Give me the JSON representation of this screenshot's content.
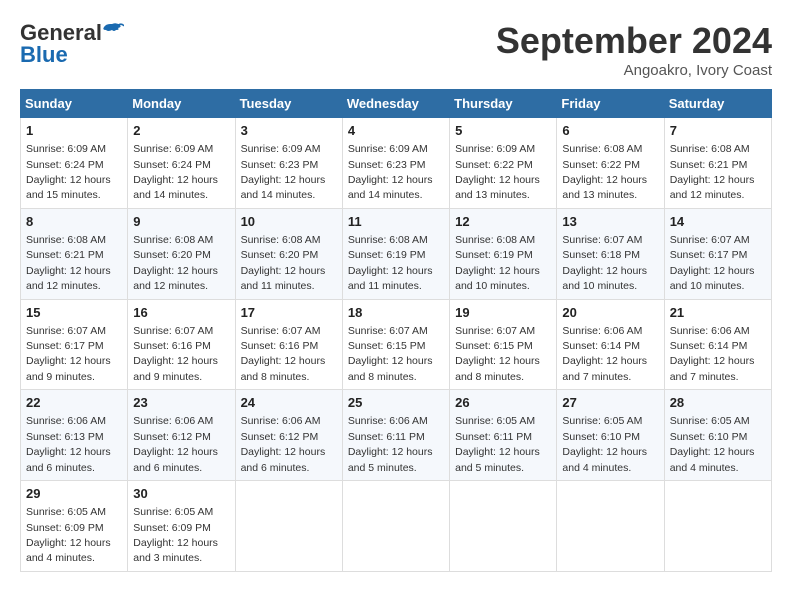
{
  "header": {
    "logo_general": "General",
    "logo_blue": "Blue",
    "month": "September 2024",
    "location": "Angoakro, Ivory Coast"
  },
  "weekdays": [
    "Sunday",
    "Monday",
    "Tuesday",
    "Wednesday",
    "Thursday",
    "Friday",
    "Saturday"
  ],
  "weeks": [
    [
      {
        "day": "1",
        "sunrise": "Sunrise: 6:09 AM",
        "sunset": "Sunset: 6:24 PM",
        "daylight": "Daylight: 12 hours and 15 minutes."
      },
      {
        "day": "2",
        "sunrise": "Sunrise: 6:09 AM",
        "sunset": "Sunset: 6:24 PM",
        "daylight": "Daylight: 12 hours and 14 minutes."
      },
      {
        "day": "3",
        "sunrise": "Sunrise: 6:09 AM",
        "sunset": "Sunset: 6:23 PM",
        "daylight": "Daylight: 12 hours and 14 minutes."
      },
      {
        "day": "4",
        "sunrise": "Sunrise: 6:09 AM",
        "sunset": "Sunset: 6:23 PM",
        "daylight": "Daylight: 12 hours and 14 minutes."
      },
      {
        "day": "5",
        "sunrise": "Sunrise: 6:09 AM",
        "sunset": "Sunset: 6:22 PM",
        "daylight": "Daylight: 12 hours and 13 minutes."
      },
      {
        "day": "6",
        "sunrise": "Sunrise: 6:08 AM",
        "sunset": "Sunset: 6:22 PM",
        "daylight": "Daylight: 12 hours and 13 minutes."
      },
      {
        "day": "7",
        "sunrise": "Sunrise: 6:08 AM",
        "sunset": "Sunset: 6:21 PM",
        "daylight": "Daylight: 12 hours and 12 minutes."
      }
    ],
    [
      {
        "day": "8",
        "sunrise": "Sunrise: 6:08 AM",
        "sunset": "Sunset: 6:21 PM",
        "daylight": "Daylight: 12 hours and 12 minutes."
      },
      {
        "day": "9",
        "sunrise": "Sunrise: 6:08 AM",
        "sunset": "Sunset: 6:20 PM",
        "daylight": "Daylight: 12 hours and 12 minutes."
      },
      {
        "day": "10",
        "sunrise": "Sunrise: 6:08 AM",
        "sunset": "Sunset: 6:20 PM",
        "daylight": "Daylight: 12 hours and 11 minutes."
      },
      {
        "day": "11",
        "sunrise": "Sunrise: 6:08 AM",
        "sunset": "Sunset: 6:19 PM",
        "daylight": "Daylight: 12 hours and 11 minutes."
      },
      {
        "day": "12",
        "sunrise": "Sunrise: 6:08 AM",
        "sunset": "Sunset: 6:19 PM",
        "daylight": "Daylight: 12 hours and 10 minutes."
      },
      {
        "day": "13",
        "sunrise": "Sunrise: 6:07 AM",
        "sunset": "Sunset: 6:18 PM",
        "daylight": "Daylight: 12 hours and 10 minutes."
      },
      {
        "day": "14",
        "sunrise": "Sunrise: 6:07 AM",
        "sunset": "Sunset: 6:17 PM",
        "daylight": "Daylight: 12 hours and 10 minutes."
      }
    ],
    [
      {
        "day": "15",
        "sunrise": "Sunrise: 6:07 AM",
        "sunset": "Sunset: 6:17 PM",
        "daylight": "Daylight: 12 hours and 9 minutes."
      },
      {
        "day": "16",
        "sunrise": "Sunrise: 6:07 AM",
        "sunset": "Sunset: 6:16 PM",
        "daylight": "Daylight: 12 hours and 9 minutes."
      },
      {
        "day": "17",
        "sunrise": "Sunrise: 6:07 AM",
        "sunset": "Sunset: 6:16 PM",
        "daylight": "Daylight: 12 hours and 8 minutes."
      },
      {
        "day": "18",
        "sunrise": "Sunrise: 6:07 AM",
        "sunset": "Sunset: 6:15 PM",
        "daylight": "Daylight: 12 hours and 8 minutes."
      },
      {
        "day": "19",
        "sunrise": "Sunrise: 6:07 AM",
        "sunset": "Sunset: 6:15 PM",
        "daylight": "Daylight: 12 hours and 8 minutes."
      },
      {
        "day": "20",
        "sunrise": "Sunrise: 6:06 AM",
        "sunset": "Sunset: 6:14 PM",
        "daylight": "Daylight: 12 hours and 7 minutes."
      },
      {
        "day": "21",
        "sunrise": "Sunrise: 6:06 AM",
        "sunset": "Sunset: 6:14 PM",
        "daylight": "Daylight: 12 hours and 7 minutes."
      }
    ],
    [
      {
        "day": "22",
        "sunrise": "Sunrise: 6:06 AM",
        "sunset": "Sunset: 6:13 PM",
        "daylight": "Daylight: 12 hours and 6 minutes."
      },
      {
        "day": "23",
        "sunrise": "Sunrise: 6:06 AM",
        "sunset": "Sunset: 6:12 PM",
        "daylight": "Daylight: 12 hours and 6 minutes."
      },
      {
        "day": "24",
        "sunrise": "Sunrise: 6:06 AM",
        "sunset": "Sunset: 6:12 PM",
        "daylight": "Daylight: 12 hours and 6 minutes."
      },
      {
        "day": "25",
        "sunrise": "Sunrise: 6:06 AM",
        "sunset": "Sunset: 6:11 PM",
        "daylight": "Daylight: 12 hours and 5 minutes."
      },
      {
        "day": "26",
        "sunrise": "Sunrise: 6:05 AM",
        "sunset": "Sunset: 6:11 PM",
        "daylight": "Daylight: 12 hours and 5 minutes."
      },
      {
        "day": "27",
        "sunrise": "Sunrise: 6:05 AM",
        "sunset": "Sunset: 6:10 PM",
        "daylight": "Daylight: 12 hours and 4 minutes."
      },
      {
        "day": "28",
        "sunrise": "Sunrise: 6:05 AM",
        "sunset": "Sunset: 6:10 PM",
        "daylight": "Daylight: 12 hours and 4 minutes."
      }
    ],
    [
      {
        "day": "29",
        "sunrise": "Sunrise: 6:05 AM",
        "sunset": "Sunset: 6:09 PM",
        "daylight": "Daylight: 12 hours and 4 minutes."
      },
      {
        "day": "30",
        "sunrise": "Sunrise: 6:05 AM",
        "sunset": "Sunset: 6:09 PM",
        "daylight": "Daylight: 12 hours and 3 minutes."
      },
      null,
      null,
      null,
      null,
      null
    ]
  ]
}
